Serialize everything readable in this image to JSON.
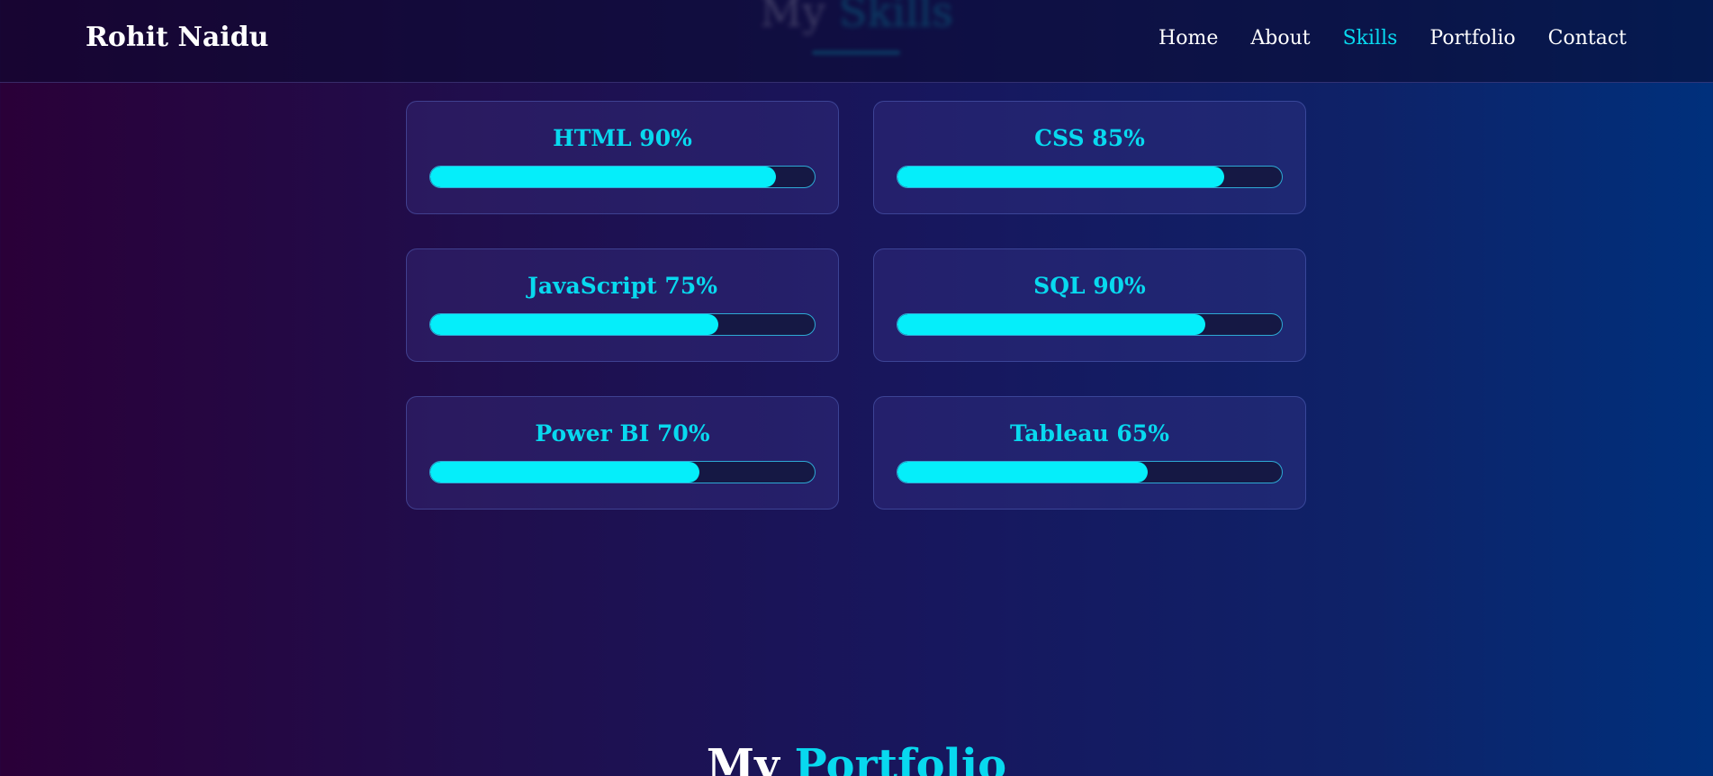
{
  "header": {
    "brand": "Rohit Naidu",
    "nav": [
      {
        "label": "Home",
        "active": false
      },
      {
        "label": "About",
        "active": false
      },
      {
        "label": "Skills",
        "active": true
      },
      {
        "label": "Portfolio",
        "active": false
      },
      {
        "label": "Contact",
        "active": false
      }
    ]
  },
  "skills_section": {
    "title_word1": "My",
    "title_word2": "Skills"
  },
  "skills": [
    {
      "label": "HTML 90%",
      "level": 0.9
    },
    {
      "label": "CSS 85%",
      "level": 0.85
    },
    {
      "label": "JavaScript 75%",
      "level": 0.75
    },
    {
      "label": "SQL 90%",
      "level": 0.8
    },
    {
      "label": "Power BI 70%",
      "level": 0.7
    },
    {
      "label": "Tableau 65%",
      "level": 0.65
    }
  ],
  "portfolio_section": {
    "title_word1": "My",
    "title_word2": "Portfolio"
  },
  "colors": {
    "accent": "#08d9ef",
    "bar_fill": "#05eefa",
    "bg_left": "#2a0038",
    "bg_right": "#00307c"
  }
}
